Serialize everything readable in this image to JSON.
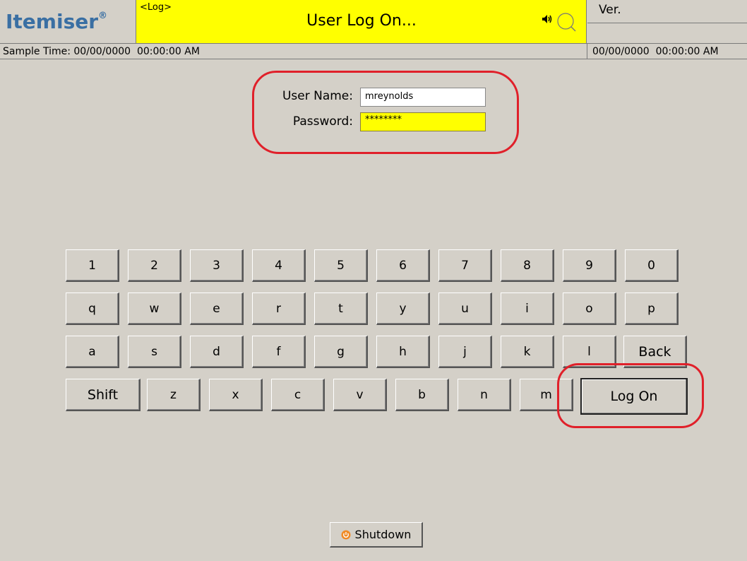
{
  "header": {
    "logo": "Itemiser",
    "logo_mark": "®",
    "tag": "<Log>",
    "title": "User Log On...",
    "version_label": "Ver.",
    "speaker_icon": "speaker-icon",
    "search_icon": "search-icon"
  },
  "status": {
    "sample_time": "Sample Time: 00/00/0000  00:00:00 AM",
    "clock": "00/00/0000  00:00:00 AM"
  },
  "login": {
    "user_label": "User Name:",
    "user_value": "mreynolds",
    "password_label": "Password:",
    "password_value": "********"
  },
  "keyboard": {
    "row1": [
      "1",
      "2",
      "3",
      "4",
      "5",
      "6",
      "7",
      "8",
      "9",
      "0"
    ],
    "row2": [
      "q",
      "w",
      "e",
      "r",
      "t",
      "y",
      "u",
      "i",
      "o",
      "p"
    ],
    "row3": [
      "a",
      "s",
      "d",
      "f",
      "g",
      "h",
      "j",
      "k",
      "l"
    ],
    "back": "Back",
    "shift": "Shift",
    "row4": [
      "z",
      "x",
      "c",
      "v",
      "b",
      "n",
      "m"
    ],
    "logon": "Log On"
  },
  "footer": {
    "shutdown_label": "Shutdown",
    "shutdown_icon": "power-icon"
  },
  "colors": {
    "title_bar": "#ffff00",
    "logo": "#3a6fa3",
    "annotation": "#e0202a",
    "background": "#d4d0c8"
  }
}
